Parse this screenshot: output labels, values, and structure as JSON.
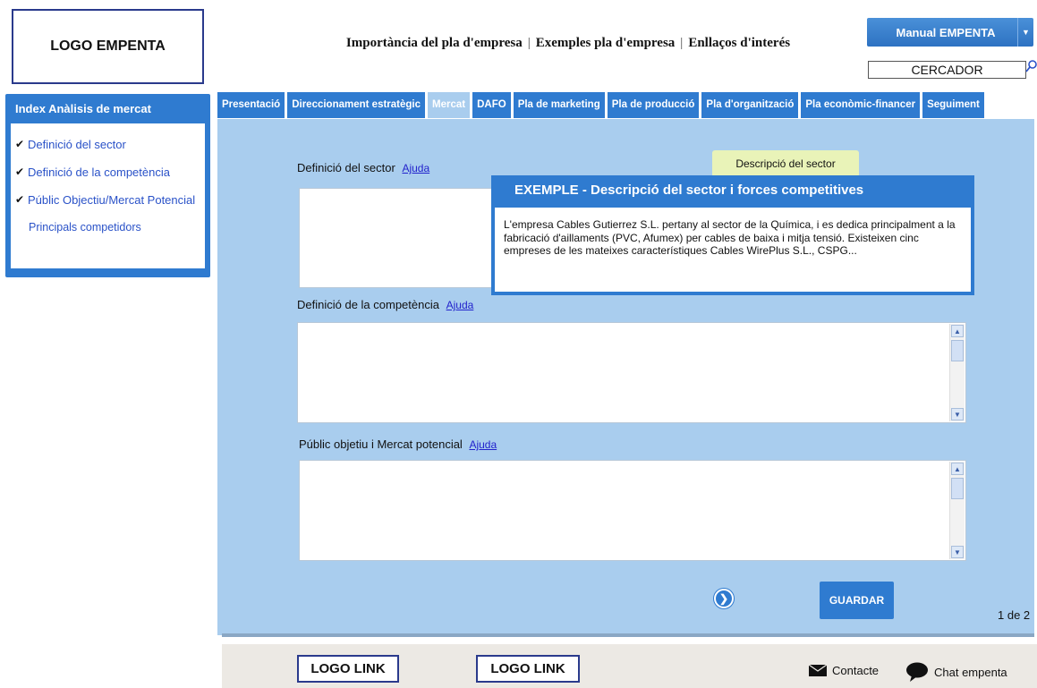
{
  "header": {
    "logo": "LOGO EMPENTA",
    "nav": [
      "Importància del pla d'empresa",
      "Exemples pla d'empresa",
      "Enllaços d'interés"
    ],
    "manual_button": "Manual EMPENTA",
    "search_placeholder": "CERCADOR"
  },
  "sidebar": {
    "title": "Index Anàlisis de mercat",
    "items": [
      {
        "label": "Definició del sector",
        "checked": true
      },
      {
        "label": "Definició de la competència",
        "checked": true
      },
      {
        "label": "Públic Objectiu/Mercat Potencial",
        "checked": true
      },
      {
        "label": "Principals competidors",
        "checked": false
      }
    ]
  },
  "tabs": [
    {
      "label": "Presentació",
      "active": false
    },
    {
      "label": "Direccionament estratègic",
      "active": false
    },
    {
      "label": "Mercat",
      "active": true
    },
    {
      "label": "DAFO",
      "active": false
    },
    {
      "label": "Pla de marketing",
      "active": false
    },
    {
      "label": "Pla de producció",
      "active": false
    },
    {
      "label": "Pla d'organització",
      "active": false
    },
    {
      "label": "Pla econòmic-financer",
      "active": false
    },
    {
      "label": "Seguiment",
      "active": false
    }
  ],
  "form": {
    "sector_label": "Definició del sector",
    "competence_label": "Definició de la competència",
    "public_label": "Públic objetiu i Mercat potencial",
    "help_link": "Ajuda",
    "save_button": "GUARDAR",
    "pager": "1 de 2"
  },
  "tooltip": "Descripció del sector",
  "example": {
    "title": "EXEMPLE -  Descripció del sector i forces competitives",
    "body": "L'empresa Cables Gutierrez S.L. pertany al sector de la Química, i es dedica principalment a la fabricació d'aillaments (PVC, Afumex) per cables de baixa i mitja tensió. Existeixen cinc empreses de les mateixes característiques Cables WirePlus S.L.,  CSPG..."
  },
  "footer": {
    "logo_link_1": "LOGO LINK",
    "logo_link_2": "LOGO LINK",
    "contact": "Contacte",
    "chat": "Chat empenta"
  },
  "colors": {
    "primary_blue": "#2f7bd0",
    "panel_blue": "#a9cdee",
    "tooltip_bg": "#e9f3b8",
    "footer_bg": "#ece9e4"
  }
}
